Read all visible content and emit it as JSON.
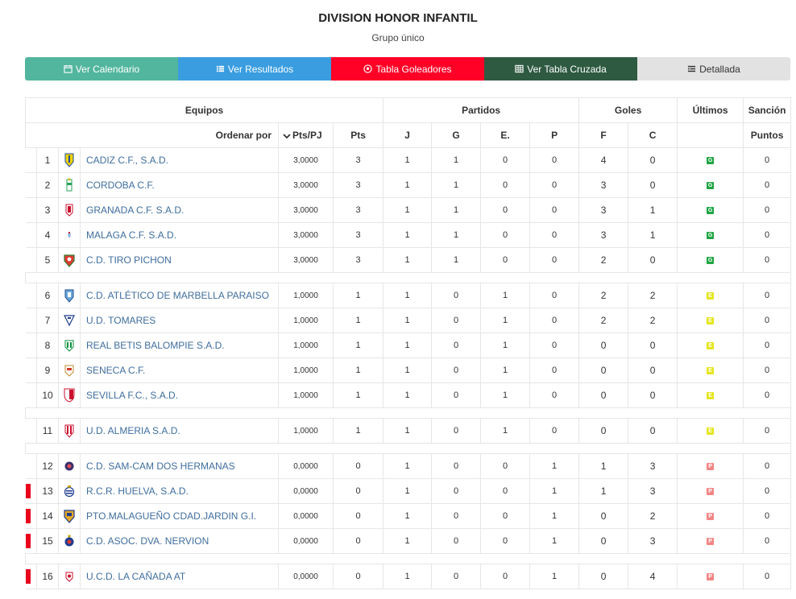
{
  "page": {
    "title": "DIVISION HONOR INFANTIL",
    "subtitle": "Grupo único"
  },
  "nav": {
    "calendario": "Ver Calendario",
    "resultados": "Ver Resultados",
    "goleadores": "Tabla Goleadores",
    "cruzada": "Ver Tabla Cruzada",
    "detallada": "Detallada"
  },
  "colors": {
    "calendario": "#52b69e",
    "resultados": "#3a9de0",
    "goleadores": "#ff0026",
    "cruzada": "#2e5a41",
    "detallada": "#e2e2e2",
    "badge_g": "#1fa543",
    "badge_e": "#e5e51c",
    "badge_p": "#f28585",
    "relegation_flag": "#e8001c",
    "team_link": "#3f6e9e"
  },
  "table": {
    "group_headers": {
      "equipos": "Equipos",
      "partidos": "Partidos",
      "goles": "Goles",
      "ultimos": "Últimos",
      "sancion": "Sanción"
    },
    "column_headers": {
      "ordenar": "Ordenar por",
      "pts_pj": "Pts/PJ",
      "pts": "Pts",
      "j": "J",
      "g": "G",
      "e": "E.",
      "p": "P",
      "f": "F",
      "c": "C",
      "puntos": "Puntos"
    },
    "teams": [
      {
        "pos": "1",
        "name": "CADIZ C.F., S.A.D.",
        "crest": "crest-cadiz",
        "pts_pj": "3,0000",
        "pts": "3",
        "j": "1",
        "g": "1",
        "e": "0",
        "p": "0",
        "f": "4",
        "c": "0",
        "last": "G",
        "sancion": "0",
        "flag": false
      },
      {
        "pos": "2",
        "name": "CORDOBA C.F.",
        "crest": "crest-cordoba",
        "pts_pj": "3,0000",
        "pts": "3",
        "j": "1",
        "g": "1",
        "e": "0",
        "p": "0",
        "f": "3",
        "c": "0",
        "last": "G",
        "sancion": "0",
        "flag": false
      },
      {
        "pos": "3",
        "name": "GRANADA C.F. S.A.D.",
        "crest": "crest-granada",
        "pts_pj": "3,0000",
        "pts": "3",
        "j": "1",
        "g": "1",
        "e": "0",
        "p": "0",
        "f": "3",
        "c": "1",
        "last": "G",
        "sancion": "0",
        "flag": false
      },
      {
        "pos": "4",
        "name": "MALAGA C.F. S.A.D.",
        "crest": "crest-malaga",
        "pts_pj": "3,0000",
        "pts": "3",
        "j": "1",
        "g": "1",
        "e": "0",
        "p": "0",
        "f": "3",
        "c": "1",
        "last": "G",
        "sancion": "0",
        "flag": false
      },
      {
        "pos": "5",
        "name": "C.D. TIRO PICHON",
        "crest": "crest-tiro-pichon",
        "pts_pj": "3,0000",
        "pts": "3",
        "j": "1",
        "g": "1",
        "e": "0",
        "p": "0",
        "f": "2",
        "c": "0",
        "last": "G",
        "sancion": "0",
        "flag": false
      },
      {
        "pos": "6",
        "name": "C.D. ATLÉTICO DE MARBELLA PARAISO",
        "crest": "crest-marbella",
        "pts_pj": "1,0000",
        "pts": "1",
        "j": "1",
        "g": "0",
        "e": "1",
        "p": "0",
        "f": "2",
        "c": "2",
        "last": "E",
        "sancion": "0",
        "flag": false
      },
      {
        "pos": "7",
        "name": "U.D. TOMARES",
        "crest": "crest-tomares",
        "pts_pj": "1,0000",
        "pts": "1",
        "j": "1",
        "g": "0",
        "e": "1",
        "p": "0",
        "f": "2",
        "c": "2",
        "last": "E",
        "sancion": "0",
        "flag": false
      },
      {
        "pos": "8",
        "name": "REAL BETIS BALOMPIE S.A.D.",
        "crest": "crest-betis",
        "pts_pj": "1,0000",
        "pts": "1",
        "j": "1",
        "g": "0",
        "e": "1",
        "p": "0",
        "f": "0",
        "c": "0",
        "last": "E",
        "sancion": "0",
        "flag": false
      },
      {
        "pos": "9",
        "name": "SENECA C.F.",
        "crest": "crest-seneca",
        "pts_pj": "1,0000",
        "pts": "1",
        "j": "1",
        "g": "0",
        "e": "1",
        "p": "0",
        "f": "0",
        "c": "0",
        "last": "E",
        "sancion": "0",
        "flag": false
      },
      {
        "pos": "10",
        "name": "SEVILLA F.C., S.A.D.",
        "crest": "crest-sevilla",
        "pts_pj": "1,0000",
        "pts": "1",
        "j": "1",
        "g": "0",
        "e": "1",
        "p": "0",
        "f": "0",
        "c": "0",
        "last": "E",
        "sancion": "0",
        "flag": false
      },
      {
        "pos": "11",
        "name": "U.D. ALMERIA S.A.D.",
        "crest": "crest-almeria",
        "pts_pj": "1,0000",
        "pts": "1",
        "j": "1",
        "g": "0",
        "e": "1",
        "p": "0",
        "f": "0",
        "c": "0",
        "last": "E",
        "sancion": "0",
        "flag": false
      },
      {
        "pos": "12",
        "name": "C.D. SAM-CAM DOS HERMANAS",
        "crest": "crest-sam-cam",
        "pts_pj": "0,0000",
        "pts": "0",
        "j": "1",
        "g": "0",
        "e": "0",
        "p": "1",
        "f": "1",
        "c": "3",
        "last": "P",
        "sancion": "0",
        "flag": false
      },
      {
        "pos": "13",
        "name": "R.C.R. HUELVA, S.A.D.",
        "crest": "crest-huelva",
        "pts_pj": "0,0000",
        "pts": "0",
        "j": "1",
        "g": "0",
        "e": "0",
        "p": "1",
        "f": "1",
        "c": "3",
        "last": "P",
        "sancion": "0",
        "flag": true
      },
      {
        "pos": "14",
        "name": "PTO.MALAGUEÑO CDAD.JARDIN G.I.",
        "crest": "crest-pto-malagueno",
        "pts_pj": "0,0000",
        "pts": "0",
        "j": "1",
        "g": "0",
        "e": "0",
        "p": "1",
        "f": "0",
        "c": "2",
        "last": "P",
        "sancion": "0",
        "flag": true
      },
      {
        "pos": "15",
        "name": "C.D. ASOC. DVA. NERVION",
        "crest": "crest-nervion",
        "pts_pj": "0,0000",
        "pts": "0",
        "j": "1",
        "g": "0",
        "e": "0",
        "p": "1",
        "f": "0",
        "c": "3",
        "last": "P",
        "sancion": "0",
        "flag": true
      },
      {
        "pos": "16",
        "name": "U.C.D. LA CAÑADA AT",
        "crest": "crest-la-canada",
        "pts_pj": "0,0000",
        "pts": "0",
        "j": "1",
        "g": "0",
        "e": "0",
        "p": "1",
        "f": "0",
        "c": "4",
        "last": "P",
        "sancion": "0",
        "flag": true
      }
    ]
  }
}
